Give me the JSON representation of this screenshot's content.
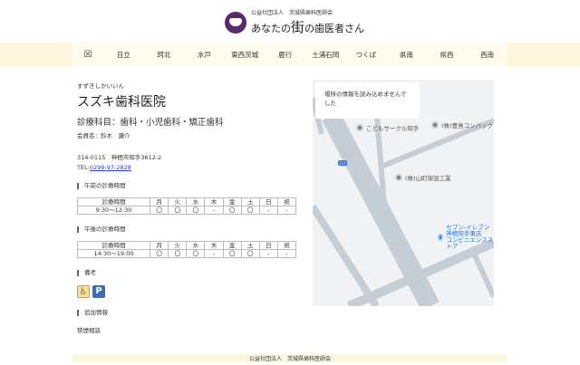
{
  "header": {
    "org_small": "公益社団法人　茨城県歯科医師会",
    "tagline_pre": "あなたの",
    "tagline_big": "街",
    "tagline_post": "の歯医者さん"
  },
  "nav": {
    "home_icon": "☒",
    "items": [
      "日立",
      "珂北",
      "水戸",
      "東西茨城",
      "鹿行",
      "土浦石岡",
      "つくば",
      "県南",
      "県西",
      "西南"
    ]
  },
  "clinic": {
    "kana": "すずきしかいいん",
    "name": "スズキ歯科医院",
    "departments": "診療科目：歯科・小児歯科・矯正歯科",
    "member": "会員名：鈴木　謙介",
    "address": "314-0115　神栖市知手3612-2",
    "tel_label": "TEL:",
    "tel": "0299-97-2828"
  },
  "am": {
    "title": "午前の診療時間",
    "headers": [
      "診療時間",
      "月",
      "火",
      "水",
      "木",
      "金",
      "土",
      "日",
      "祝"
    ],
    "row": [
      "9:30〜12:30",
      "〇",
      "〇",
      "〇",
      "-",
      "〇",
      "〇",
      "-",
      "-"
    ]
  },
  "pm": {
    "title": "午後の診療時間",
    "headers": [
      "診療時間",
      "月",
      "火",
      "水",
      "木",
      "金",
      "土",
      "日",
      "祝"
    ],
    "row": [
      "14:30〜19:00",
      "〇",
      "〇",
      "〇",
      "-",
      "〇",
      "〇",
      "-",
      "-"
    ]
  },
  "remarks": {
    "title": "備考",
    "icons": [
      "wheelchair-icon",
      "parking-icon"
    ],
    "parking_label": "P",
    "wheelchair_label": "♿"
  },
  "extra": {
    "title": "追加情報",
    "text": "禁煙相談"
  },
  "map": {
    "error": "場所の情報を読み込めませんでした",
    "road_number": "117",
    "pois": [
      "こどもサークル知手",
      "(株)豊島コンパック",
      "(株)山町架設工業",
      "セブン-イレブン 神栖知手東店",
      "コンビニエンスストア"
    ]
  },
  "footer": {
    "text": "公益社団法人　茨城県歯科医師会"
  }
}
